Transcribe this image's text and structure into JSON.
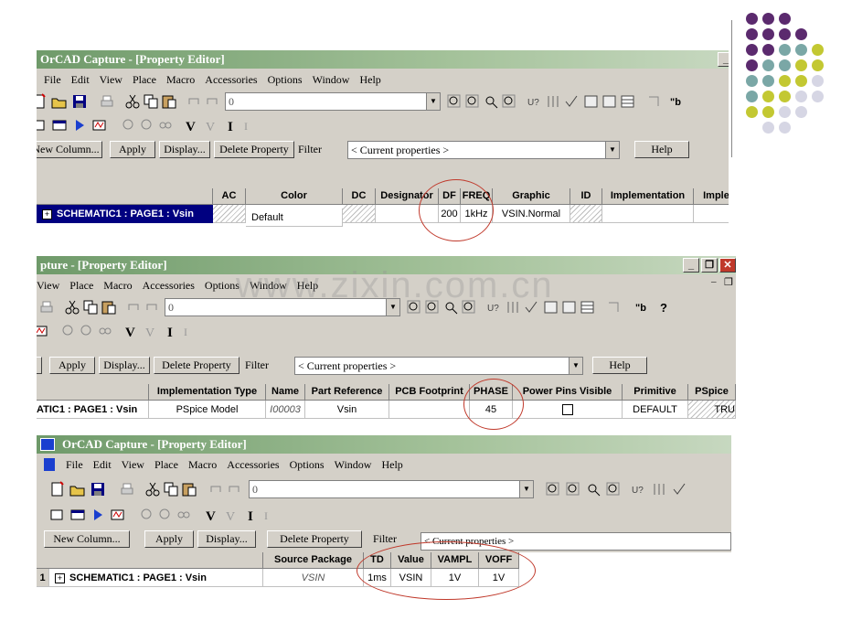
{
  "decor": {
    "dots": [
      [
        "#5b2a6e",
        "#5b2a6e",
        "#5b2a6e",
        "",
        ""
      ],
      [
        "#5b2a6e",
        "#5b2a6e",
        "#5b2a6e",
        "#5b2a6e",
        ""
      ],
      [
        "#5b2a6e",
        "#5b2a6e",
        "#7aa7a6",
        "#7aa7a6",
        "#c3c832"
      ],
      [
        "#5b2a6e",
        "#7aa7a6",
        "#7aa7a6",
        "#c3c832",
        "#c3c832"
      ],
      [
        "#7aa7a6",
        "#7aa7a6",
        "#c3c832",
        "#c3c832",
        "#d6d6e4"
      ],
      [
        "#7aa7a6",
        "#c3c832",
        "#c3c832",
        "#d6d6e4",
        "#d6d6e4"
      ],
      [
        "#c3c832",
        "#c3c832",
        "#d6d6e4",
        "#d6d6e4",
        ""
      ],
      [
        "",
        "#d6d6e4",
        "#d6d6e4",
        "",
        ""
      ]
    ]
  },
  "watermark": "www.zixin.com.cn",
  "panel1": {
    "title": "OrCAD Capture - [Property Editor]",
    "menu": [
      "File",
      "Edit",
      "View",
      "Place",
      "Macro",
      "Accessories",
      "Options",
      "Window",
      "Help"
    ],
    "combo_value": "0",
    "buttons": {
      "new_column": "New Column...",
      "apply": "Apply",
      "display": "Display...",
      "delete": "Delete Property",
      "filter": "Filter",
      "help": "Help"
    },
    "filter_value": "< Current properties >",
    "columns": [
      "AC",
      "Color",
      "DC",
      "Designator",
      "DF",
      "FREQ",
      "Graphic",
      "ID",
      "Implementation",
      "Imple"
    ],
    "row_label": "SCHEMATIC1 : PAGE1 : Vsin",
    "cells": {
      "color": "Default",
      "df": "200",
      "freq": "1kHz",
      "graphic": "VSIN.Normal"
    }
  },
  "panel2": {
    "title": "pture - [Property Editor]",
    "menu": [
      "View",
      "Place",
      "Macro",
      "Accessories",
      "Options",
      "Window",
      "Help"
    ],
    "combo_value": "0",
    "buttons": {
      "apply": "Apply",
      "display": "Display...",
      "delete": "Delete Property",
      "filter": "Filter",
      "help": "Help"
    },
    "filter_value": "< Current properties >",
    "columns": [
      "Implementation Type",
      "Name",
      "Part Reference",
      "PCB Footprint",
      "PHASE",
      "Power Pins Visible",
      "Primitive",
      "PSpice"
    ],
    "row_label": "ATIC1 : PAGE1 : Vsin",
    "cells": {
      "impl_type": "PSpice Model",
      "name": "I00003",
      "part_ref": "Vsin",
      "phase": "45",
      "primitive": "DEFAULT",
      "pspice": "TRU"
    }
  },
  "panel3": {
    "title": "OrCAD Capture - [Property Editor]",
    "menu": [
      "File",
      "Edit",
      "View",
      "Place",
      "Macro",
      "Accessories",
      "Options",
      "Window",
      "Help"
    ],
    "combo_value": "0",
    "buttons": {
      "new_column": "New Column...",
      "apply": "Apply",
      "display": "Display...",
      "delete": "Delete Property",
      "filter": "Filter"
    },
    "filter_value": "< Current properties >",
    "columns": [
      "Source Package",
      "TD",
      "Value",
      "VAMPL",
      "VOFF"
    ],
    "row_number": "1",
    "row_label": "SCHEMATIC1 : PAGE1 : Vsin",
    "cells": {
      "source_package": "VSIN",
      "td": "1ms",
      "value": "VSIN",
      "vampl": "1V",
      "voff": "1V"
    }
  }
}
